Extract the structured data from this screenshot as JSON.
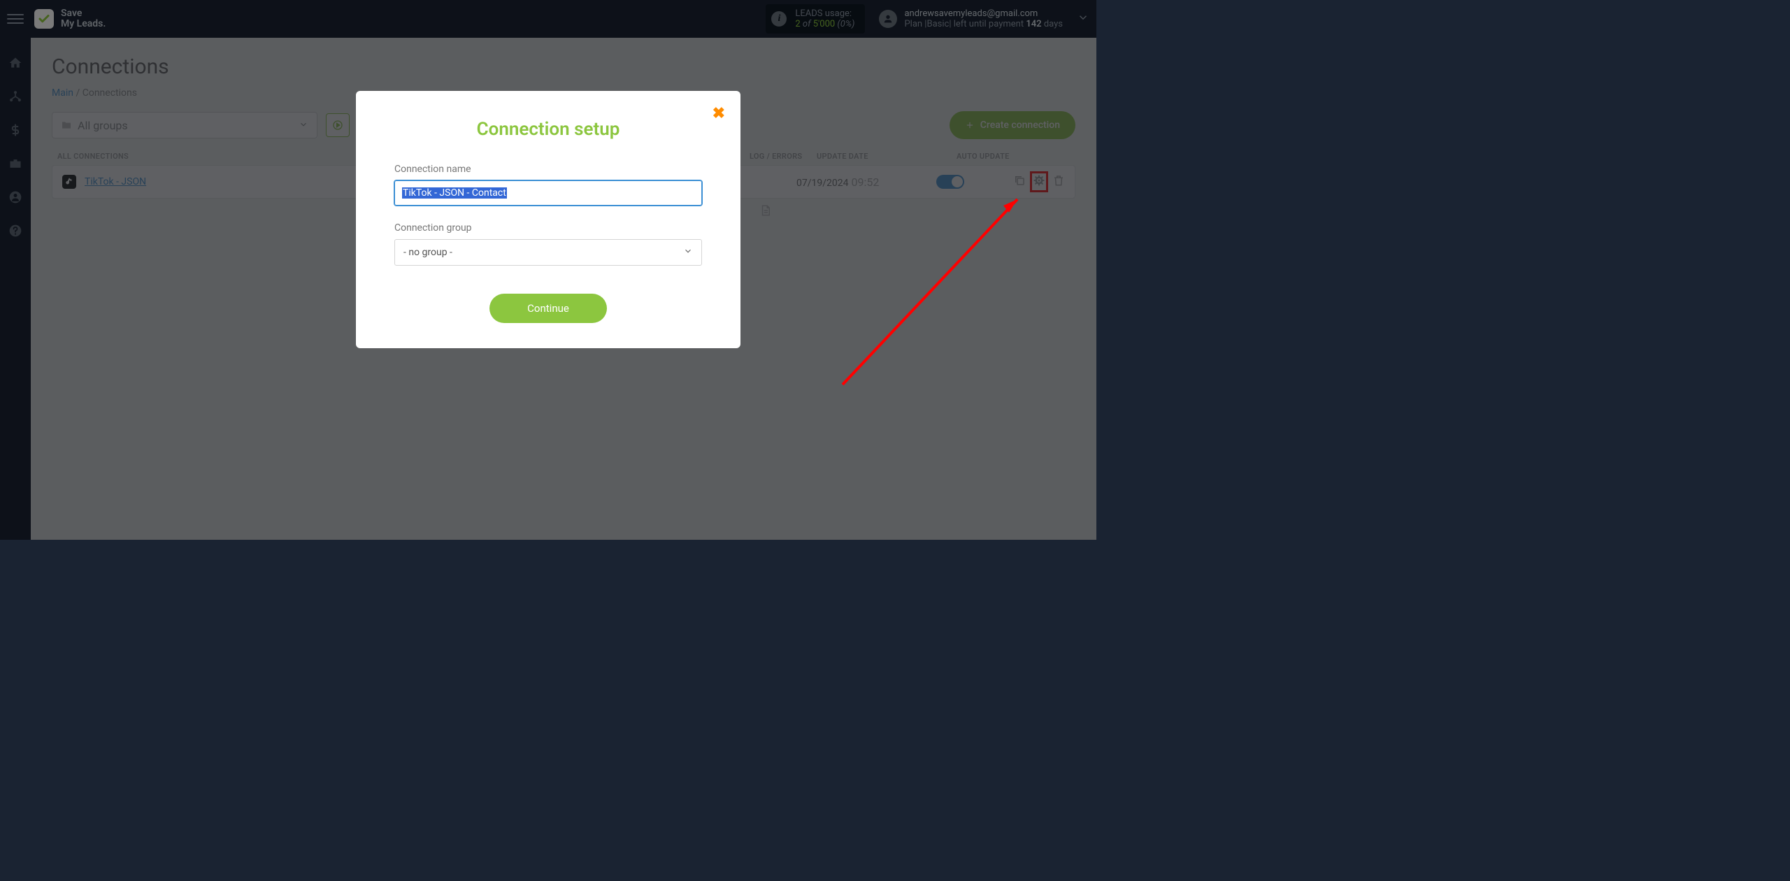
{
  "header": {
    "brand_line1": "Save",
    "brand_line2": "My Leads.",
    "leads_label": "LEADS usage:",
    "leads_used": "2",
    "leads_of": " of ",
    "leads_total": "5'000",
    "leads_pct": "(0%)",
    "user_email": "andrewsavemyleads@gmail.com",
    "plan_prefix": "Plan |",
    "plan_name": "Basic",
    "plan_mid": "| left until payment ",
    "plan_days_num": "142",
    "plan_days_suffix": " days"
  },
  "page": {
    "title": "Connections",
    "breadcrumb_main": "Main",
    "breadcrumb_sep": " / ",
    "breadcrumb_current": "Connections"
  },
  "toolbar": {
    "groups_dd": "All groups",
    "create_btn": "Create connection"
  },
  "table": {
    "header_all": "ALL CONNECTIONS",
    "header_log": "LOG / ERRORS",
    "header_date": "UPDATE DATE",
    "header_auto": "AUTO UPDATE"
  },
  "rows": [
    {
      "name": "TikTok - JSON",
      "date": "07/19/2024",
      "time": "09:52",
      "auto_update": true
    }
  ],
  "modal": {
    "title": "Connection setup",
    "name_label": "Connection name",
    "name_value": "TikTok - JSON - Contact",
    "group_label": "Connection group",
    "group_value": "- no group -",
    "continue": "Continue"
  }
}
